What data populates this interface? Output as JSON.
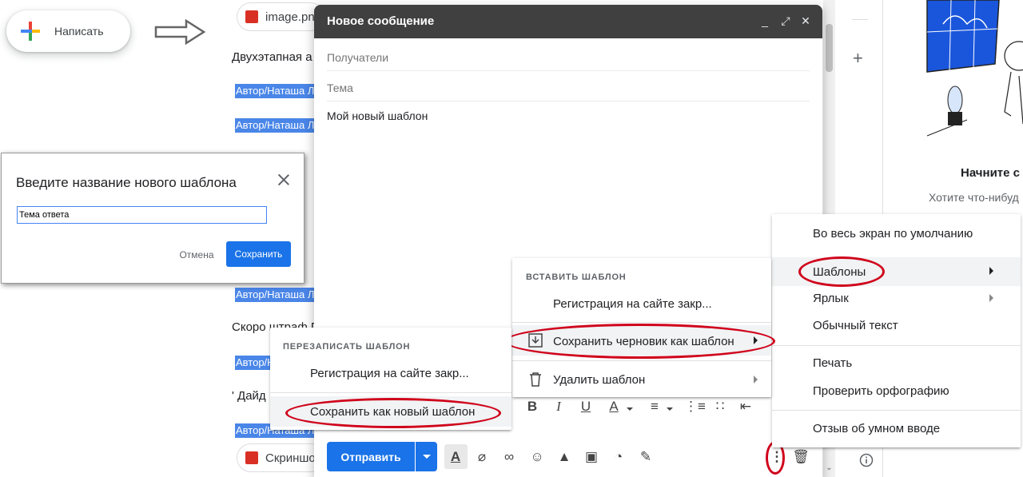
{
  "compose_button": {
    "label": "Написать"
  },
  "background_list": {
    "chip_top": "image.png",
    "row1": "Двухэтапная а",
    "tags": [
      "Автор/Наташа Л",
      "Автор/Наташа Л",
      "Автор/Наташа Л",
      "Автор/Наташа Л",
      "Автор/Наташа Л",
      "Автор/Наташа Л"
    ],
    "row2": "Скоро штраф Г",
    "row3": "' Дайд",
    "chip_bottom": "Скриншо"
  },
  "right_panel": {
    "title": "Начните с",
    "subtitle": "Хотите что-нибуд"
  },
  "compose": {
    "title": "Новое сообщение",
    "recipients_placeholder": "Получатели",
    "subject_placeholder": "Тема",
    "body": "Мой новый шаблон",
    "send_label": "Отправить",
    "header_icons": [
      "minimize-icon",
      "fullscreen-icon",
      "close-icon"
    ],
    "toolbar_icons": [
      "text-format-icon",
      "attach-icon",
      "link-icon",
      "emoji-icon",
      "drive-icon",
      "photo-icon",
      "confidential-icon",
      "signature-icon"
    ],
    "format_icons": [
      "bold-icon",
      "italic-icon",
      "underline-icon",
      "text-color-icon",
      "align-icon",
      "numbered-list-icon",
      "bulleted-list-icon",
      "indent-less-icon"
    ]
  },
  "dialog": {
    "title": "Введите название нового шаблона",
    "input_value": "Тема ответа",
    "cancel_label": "Отмена",
    "save_label": "Сохранить"
  },
  "more_menu": {
    "items": [
      "Во весь экран по умолчанию",
      "Шаблоны",
      "Ярлык",
      "Обычный текст",
      "Печать",
      "Проверить орфографию",
      "Отзыв об умном вводе"
    ]
  },
  "templates_menu": {
    "heading": "ВСТАВИТЬ ШАБЛОН",
    "insert_item": "Регистрация на сайте закр...",
    "save_draft": "Сохранить черновик как шаблон",
    "delete": "Удалить шаблон"
  },
  "overwrite_menu": {
    "heading": "ПЕРЕЗАПИСАТЬ ШАБЛОН",
    "item": "Регистрация на сайте закр...",
    "save_new": "Сохранить как новый шаблон"
  },
  "colors": {
    "accent": "#1a73e8",
    "header": "#404040",
    "annotation_red": "#d0021b",
    "tag_blue": "#4a86e8"
  }
}
